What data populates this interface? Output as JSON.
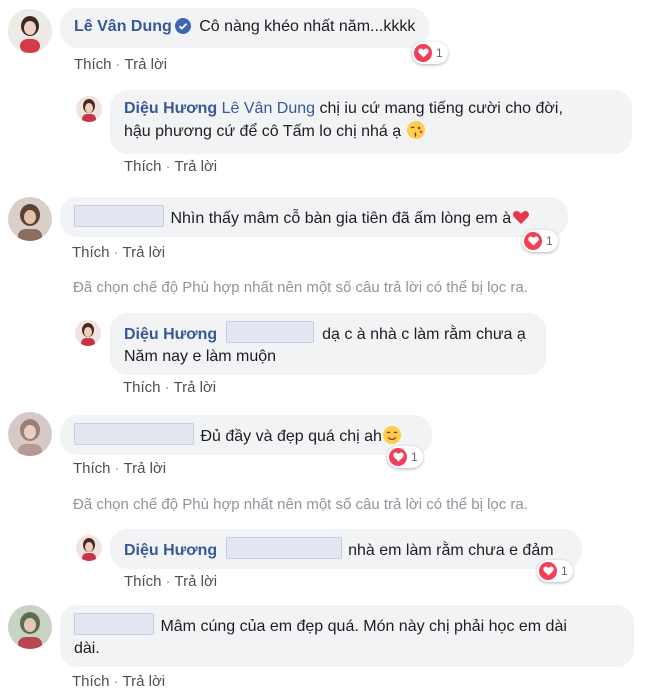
{
  "comments": [
    {
      "author": "Lê Vân Dung",
      "text": "Cô nàng khéo nhất năm...kkkk",
      "reaction_count": "1",
      "like_label": "Thích",
      "reply_label": "Trả lời"
    },
    {
      "author": "Diệu Hương",
      "mention": "Lê Vân Dung",
      "text_line1": "chị iu cứ mang tiếng cười cho đời,",
      "text_line2": "hậu phương cứ để cô Tấm lo chị nhá ạ",
      "like_label": "Thích",
      "reply_label": "Trả lời"
    },
    {
      "text": "Nhìn thấy mâm cỗ bàn gia tiên đã ấm lòng em à",
      "reaction_count": "1",
      "like_label": "Thích",
      "reply_label": "Trả lời"
    },
    {
      "author": "Diệu Hương",
      "text_line1": "dạ c à nhà c làm rằm chưa ạ",
      "text_line2": "Năm nay e làm muộn",
      "like_label": "Thích",
      "reply_label": "Trả lời"
    },
    {
      "text": "Đủ đầy và đẹp quá chị ah",
      "reaction_count": "1",
      "like_label": "Thích",
      "reply_label": "Trả lời"
    },
    {
      "author": "Diệu Hương",
      "text": "nhà em làm rằm chưa e đảm",
      "reaction_count": "1",
      "like_label": "Thích",
      "reply_label": "Trả lời"
    },
    {
      "text_line1": "Mâm cúng của em đẹp quá. Món này chị phải học em dài",
      "text_line2": "dài.",
      "like_label": "Thích",
      "reply_label": "Trả lời"
    }
  ],
  "filter_note": "Đã chọn chế độ Phù hợp nhất nên một số câu trả lời có thể bị lọc ra.",
  "icons": [
    "verified-badge-icon",
    "heart-reaction-icon",
    "kiss-emoji",
    "heart-emoji",
    "smile-emoji"
  ],
  "colors": {
    "name": "#385898",
    "bubble": "#f2f3f5",
    "meta": "#90949c",
    "heart": "#f33e58"
  }
}
